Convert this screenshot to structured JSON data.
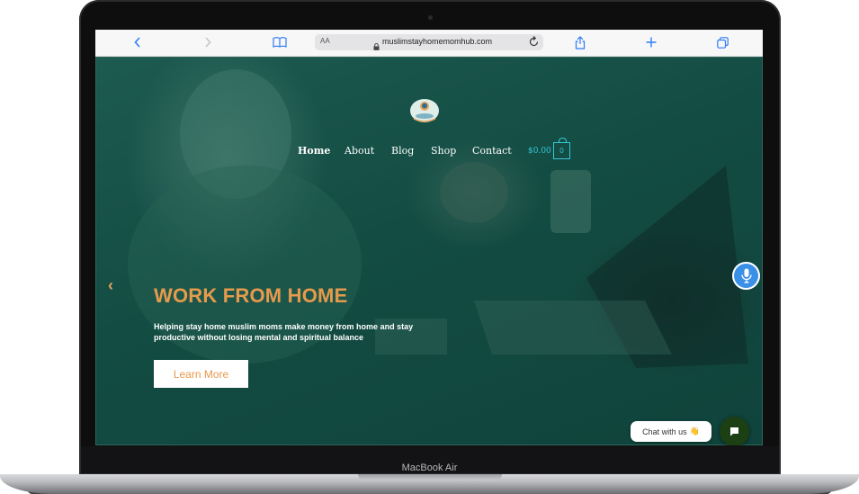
{
  "device": {
    "model_label": "MacBook Air"
  },
  "browser": {
    "text_size_label": "AA",
    "url": "muslimstayhomemomhub.com",
    "icons": [
      "chevron-left-icon",
      "chevron-right-icon",
      "book-icon",
      "lock-icon",
      "reload-icon",
      "share-icon",
      "plus-icon",
      "tabs-icon"
    ]
  },
  "site": {
    "nav": [
      {
        "label": "Home",
        "active": true
      },
      {
        "label": "About"
      },
      {
        "label": "Blog"
      },
      {
        "label": "Shop"
      },
      {
        "label": "Contact"
      }
    ],
    "cart": {
      "total": "$0.00",
      "count": "0"
    },
    "hero": {
      "prev_arrow": "‹",
      "headline": "WORK FROM HOME",
      "subtext": "Helping stay home muslim moms make money from home and stay productive without losing mental and spiritual balance",
      "cta_label": "Learn More",
      "slides_total": 3,
      "slide_active": 1
    },
    "chat": {
      "label": "Chat with us",
      "emoji": "👋"
    },
    "colors": {
      "accent": "#e69a4c",
      "cart": "#36c6d6",
      "hero_bg": "#134c43",
      "mic": "#3a8fe6",
      "chat_button": "#1d3f14"
    }
  }
}
